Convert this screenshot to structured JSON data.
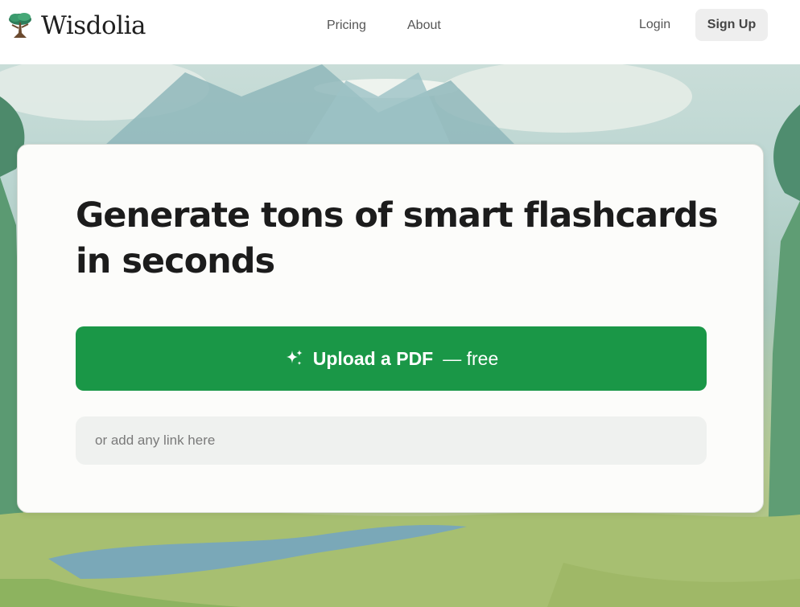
{
  "header": {
    "brand": "Wisdolia",
    "nav": {
      "pricing": "Pricing",
      "about": "About"
    },
    "login": "Login",
    "signup": "Sign Up"
  },
  "hero": {
    "headline": "Generate tons of smart flashcards in seconds",
    "upload_label": "Upload a PDF",
    "upload_suffix": "— free",
    "upload_icon": "sparkle-icon",
    "link_placeholder": "or add any link here"
  },
  "colors": {
    "primary_green": "#1a9747",
    "signup_bg": "#eeeeee",
    "input_bg": "#eff1ef"
  }
}
